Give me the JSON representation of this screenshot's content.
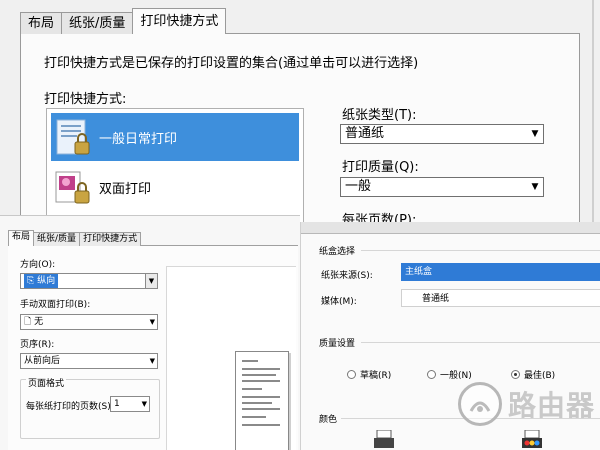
{
  "top": {
    "tabs": [
      "布局",
      "纸张/质量",
      "打印快捷方式"
    ],
    "description": "打印快捷方式是已保存的打印设置的集合(通过单击可以进行选择)",
    "list_label": "打印快捷方式:",
    "list_items": [
      "一般日常打印",
      "双面打印"
    ],
    "paper_type_label": "纸张类型(T):",
    "paper_type_value": "普通纸",
    "quality_label": "打印质量(Q):",
    "quality_value": "一般",
    "pages_per_sheet_label": "每张页数(P):"
  },
  "bottom_left": {
    "tabs": [
      "布局",
      "纸张/质量",
      "打印快捷方式"
    ],
    "orientation_label": "方向(O):",
    "orientation_value": "纵向",
    "duplex_label": "手动双面打印(B):",
    "duplex_value": "无",
    "page_order_label": "页序(R):",
    "page_order_value": "从前向后",
    "page_format_label": "页面格式",
    "pages_per_sheet_label": "每张纸打印的页数(S)",
    "pages_per_sheet_value": "1"
  },
  "bottom_right": {
    "tray_section": "纸盒选择",
    "source_label": "纸张来源(S):",
    "source_value": "主纸盒",
    "media_label": "媒体(M):",
    "media_value": "普通纸",
    "quality_section": "质量设置",
    "quality_options": [
      "草稿(R)",
      "一般(N)",
      "最佳(B)"
    ],
    "quality_selected": "最佳(B)",
    "color_section": "颜色"
  },
  "watermark": {
    "text": "路由器"
  }
}
